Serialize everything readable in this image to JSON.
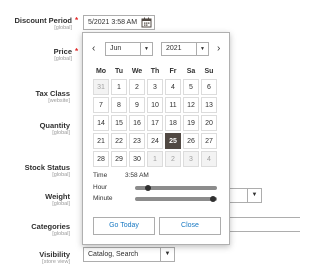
{
  "form": {
    "discount_period": {
      "label": "Discount Period",
      "scope": "[global]",
      "value": "5/2021 3:58 AM",
      "required": "*"
    },
    "price": {
      "label": "Price",
      "scope": "[global]",
      "required": "*"
    },
    "tax_class": {
      "label": "Tax Class",
      "scope": "[website]"
    },
    "quantity": {
      "label": "Quantity",
      "scope": "[global]"
    },
    "stock_status": {
      "label": "Stock Status",
      "scope": "[global]"
    },
    "weight": {
      "label": "Weight",
      "scope": "[global]"
    },
    "categories": {
      "label": "Categories",
      "scope": "[global]"
    },
    "visibility": {
      "label": "Visibility",
      "scope": "[store view]",
      "value": "Catalog, Search"
    }
  },
  "calendar": {
    "prev_icon": "chevron-left-icon",
    "next_icon": "chevron-right-icon",
    "month": "Jun",
    "year": "2021",
    "weekdays": [
      "Mo",
      "Tu",
      "We",
      "Th",
      "Fr",
      "Sa",
      "Su"
    ],
    "weeks": [
      [
        "31",
        "1",
        "2",
        "3",
        "4",
        "5",
        "6"
      ],
      [
        "7",
        "8",
        "9",
        "10",
        "11",
        "12",
        "13"
      ],
      [
        "14",
        "15",
        "16",
        "17",
        "18",
        "19",
        "20"
      ],
      [
        "21",
        "22",
        "23",
        "24",
        "25",
        "26",
        "27"
      ],
      [
        "28",
        "29",
        "30",
        "1",
        "2",
        "3",
        "4"
      ]
    ],
    "selected_day": "25",
    "time_label": "Time",
    "time_value": "3:58 AM",
    "hour_label": "Hour",
    "minute_label": "Minute",
    "hour_level": 3,
    "minute_level": 58,
    "go_today_label": "Go Today",
    "close_label": "Close"
  },
  "colors": {
    "accent": "#1979c3",
    "selected_day_bg": "#514943",
    "required": "#e22626"
  }
}
